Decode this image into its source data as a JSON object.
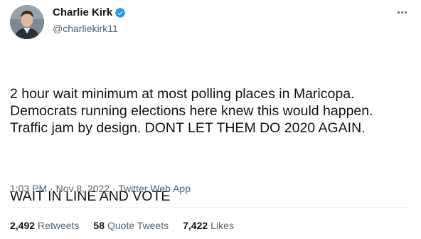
{
  "author": {
    "display_name": "Charlie Kirk",
    "handle": "@charliekirk11",
    "verified": true
  },
  "tweet": {
    "text_para1": "2 hour wait minimum at most polling places in Maricopa. Democrats running elections here knew this would happen. Traffic jam by design. DONT LET THEM DO 2020 AGAIN.",
    "text_para2": "WAIT IN LINE AND VOTE",
    "time": "1:03 PM",
    "date": "Nov 8, 2022",
    "source": "Twitter Web App",
    "separator": "·"
  },
  "stats": {
    "retweets_count": "2,492",
    "retweets_label": "Retweets",
    "quote_count": "58",
    "quote_label": "Quote Tweets",
    "likes_count": "7,422",
    "likes_label": "Likes"
  },
  "icons": {
    "verified": "verified-badge-icon",
    "more": "more-options-icon"
  },
  "colors": {
    "text": "#0f1419",
    "secondary": "#536471",
    "verified_blue": "#1d9bf0"
  }
}
